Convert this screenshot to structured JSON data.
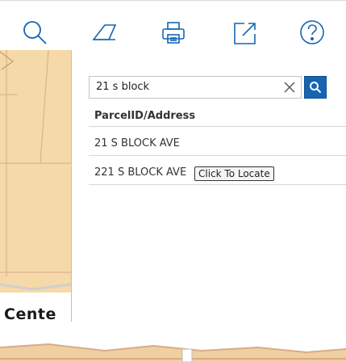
{
  "toolbar": {
    "items": [
      {
        "icon": "search-icon"
      },
      {
        "icon": "eraser-icon"
      },
      {
        "icon": "print-icon"
      },
      {
        "icon": "export-icon"
      },
      {
        "icon": "help-icon"
      }
    ],
    "icon_color": "#1565b2"
  },
  "search": {
    "value": "21 s block",
    "button_color": "#1565b2"
  },
  "results": {
    "header": "ParcelID/Address",
    "items": [
      {
        "address": "21 S BLOCK AVE"
      },
      {
        "address": "221 S BLOCK AVE",
        "action": "Click To Locate"
      }
    ]
  },
  "map": {
    "label": "Cente",
    "parcel_color": "#f5d9a8",
    "road_color": "#d8ac86"
  }
}
